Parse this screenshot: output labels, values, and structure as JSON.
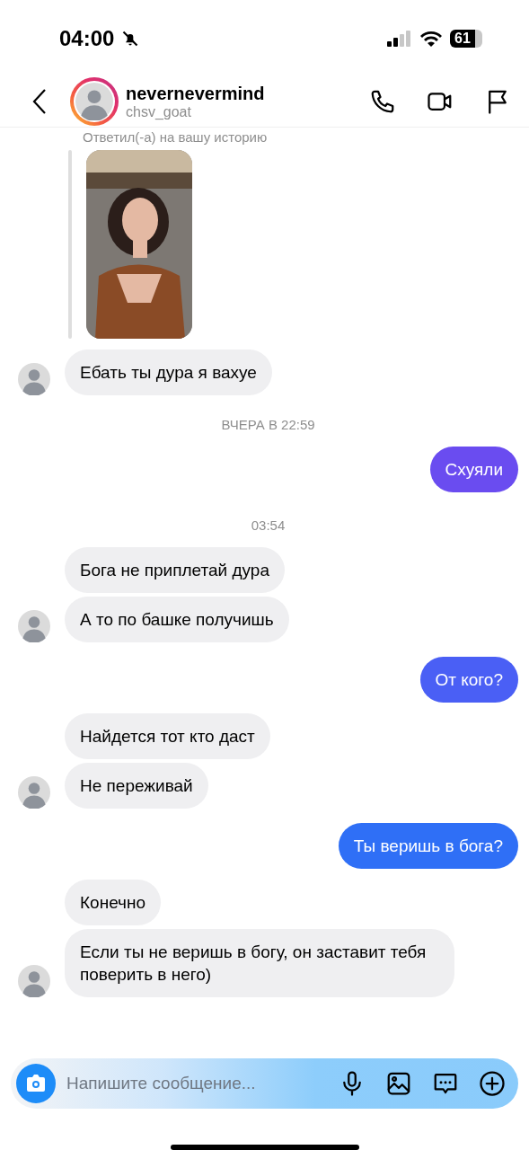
{
  "status_bar": {
    "time": "04:00",
    "battery": "61"
  },
  "header": {
    "username": "nevernevermind",
    "handle": "chsv_goat"
  },
  "messages": [
    {
      "kind": "story",
      "text": "Ответил(-а) на вашу историю"
    },
    {
      "kind": "incoming",
      "text": "Ебать ты дура я вахуе"
    },
    {
      "kind": "timestamp",
      "text": "ВЧЕРА В 22:59"
    },
    {
      "kind": "outgoing",
      "text": "Схуяли",
      "color": "#6a4cf0"
    },
    {
      "kind": "timestamp",
      "text": "03:54"
    },
    {
      "kind": "incoming",
      "text": "Бога не приплетай дура"
    },
    {
      "kind": "incoming",
      "text": "А то по башке получишь"
    },
    {
      "kind": "outgoing",
      "text": "От кого?",
      "color": "#4a5ff5"
    },
    {
      "kind": "incoming",
      "text": "Найдется тот кто даст"
    },
    {
      "kind": "incoming",
      "text": "Не переживай"
    },
    {
      "kind": "outgoing",
      "text": "Ты веришь в бога?",
      "color": "#2f6ff6"
    },
    {
      "kind": "incoming",
      "text": "Конечно"
    },
    {
      "kind": "incoming",
      "text": "Если ты не веришь в богу, он заставит тебя поверить в него)"
    }
  ],
  "composer": {
    "placeholder": "Напишите сообщение..."
  }
}
